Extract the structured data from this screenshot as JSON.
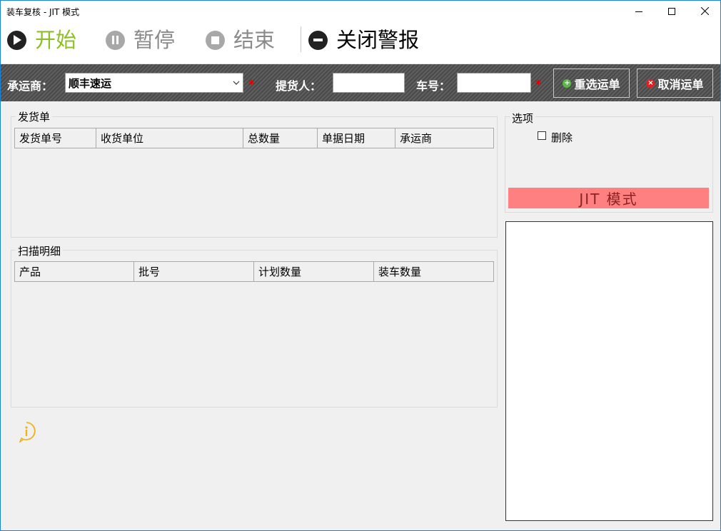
{
  "window": {
    "title": "装车复核 - JIT 模式",
    "controls": [
      "minimize",
      "maximize",
      "close"
    ]
  },
  "toolbar": {
    "start_label": "开始",
    "pause_label": "暂停",
    "stop_label": "结束",
    "alarm_label": "关闭警报",
    "colors": {
      "start": "#8cbf26",
      "disabled": "#8a8a8a",
      "alarm": "#000000"
    }
  },
  "filter": {
    "carrier_label": "承运商：",
    "carrier_value": "顺丰速运",
    "picker_label": "提货人：",
    "picker_value": "",
    "vehicle_label": "车号：",
    "vehicle_value": "",
    "required_mark": "*",
    "reselect_label": "重选运单",
    "cancel_label": "取消运单"
  },
  "shipping": {
    "title": "发货单",
    "columns": [
      "发货单号",
      "收货单位",
      "总数量",
      "单据日期",
      "承运商"
    ],
    "rows": []
  },
  "scan": {
    "title": "扫描明细",
    "columns": [
      "产品",
      "批号",
      "计划数量",
      "装车数量"
    ],
    "rows": []
  },
  "options": {
    "title": "选项",
    "delete_label": "删除",
    "delete_checked": false,
    "mode_banner": "JIT 模式",
    "banner_color": "#ff8080"
  },
  "icons": {
    "start": "play-icon",
    "pause": "pause-icon",
    "stop": "stop-icon",
    "alarm": "minus-circle-icon",
    "reselect": "plus-circle-icon",
    "cancel": "x-circle-icon",
    "info": "info-bubble-icon"
  }
}
